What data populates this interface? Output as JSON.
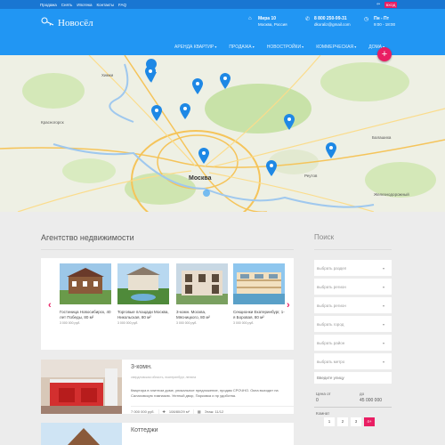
{
  "topbar": {
    "links": [
      "Продажа",
      "Снять",
      "Ипотека",
      "Контакты",
      "FAQ"
    ],
    "login": "ВХОД"
  },
  "header": {
    "logo": "Новосёл",
    "address_title": "Мира 10",
    "address_sub": "Москва, Россия",
    "phone": "8 800 250-99-31",
    "email": "dkoraliz@gmail.com",
    "hours_title": "Пн - Пт",
    "hours_sub": "9:00 - 18:00"
  },
  "nav": [
    "АРЕНДА КВАРТИР",
    "ПРОДАЖА",
    "НОВОСТРОЙКИ",
    "КОММЕРЧЕСКАЯ",
    "ДОМА"
  ],
  "map": {
    "places": [
      {
        "name": "Химки"
      },
      {
        "name": "Красногорск"
      },
      {
        "name": "Москва"
      },
      {
        "name": "Балашиха"
      },
      {
        "name": "Реутов"
      },
      {
        "name": "Железнодорожный"
      }
    ]
  },
  "main": {
    "title": "Агентство недвижимости"
  },
  "featured": [
    {
      "title": "Гостиница Новосибирск, 40 лет Победы, 80 м²",
      "price": "3 000 000 руб."
    },
    {
      "title": "Торговые площади Москва, Никольская, 80 м²",
      "price": "3 000 000 руб."
    },
    {
      "title": "3-комн. Москва, Мясницкого, 80 м²",
      "price": "3 000 000 руб."
    },
    {
      "title": "Секционки Екатеринбург, 1-я Боровая, 80 м²",
      "price": "3 000 000 руб."
    }
  ],
  "listings": [
    {
      "title": "3-комн.",
      "address": "свердловская область, екатеринбург, ленина",
      "desc": "Квартира в элитном доме, уникальное предложение, продам СРОЧНО. Окна выходят на Салаховскую гимназию. Уютный двор, Парковка и пр удобства.",
      "price": "7 000 000 руб.",
      "area": "108/80/29 м²",
      "floor": "Этаж: 11/12"
    },
    {
      "title": "Коттеджи"
    }
  ],
  "search": {
    "title": "Поиск",
    "fields": [
      "выбрать раздел",
      "выбрать регион",
      "выбрать регион",
      "выбрать город",
      "выбрать район",
      "выбрать метро",
      "Введите улицу"
    ],
    "price_label": "Цена от",
    "price_to": "до",
    "price_min": "0",
    "price_max": "45 000 000",
    "rooms_label": "Комнат",
    "rooms": [
      "1",
      "2",
      "3",
      "4+"
    ]
  }
}
